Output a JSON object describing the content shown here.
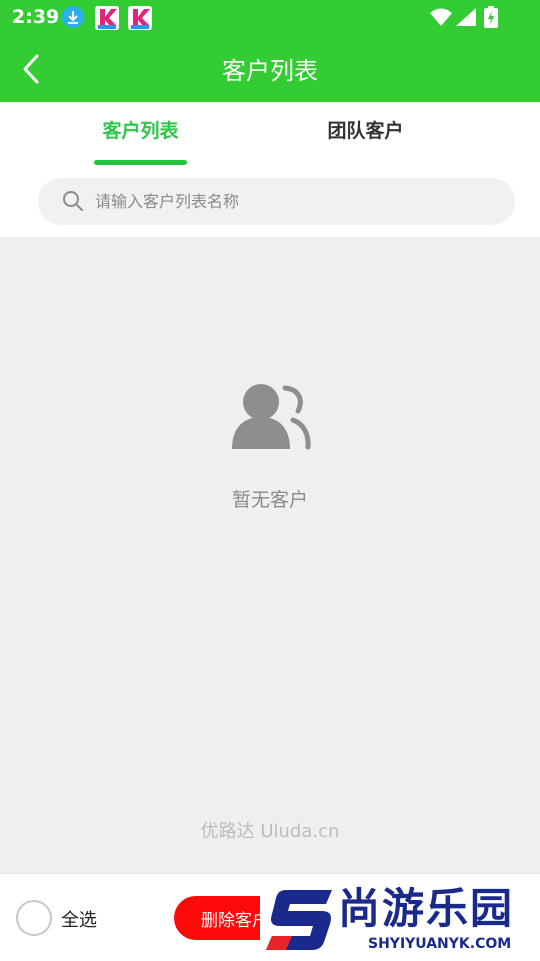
{
  "status_bar": {
    "time": "2:39"
  },
  "header": {
    "title": "客户列表"
  },
  "tabs": [
    {
      "label": "客户列表",
      "active": true
    },
    {
      "label": "团队客户",
      "active": false
    }
  ],
  "search": {
    "placeholder": "请输入客户列表名称",
    "value": ""
  },
  "empty_state": {
    "text": "暂无客户",
    "icon": "customers-icon"
  },
  "watermark": "优路达 Uluda.cn",
  "footer": {
    "select_all_label": "全选",
    "delete_label": "删除客户"
  },
  "brand": {
    "name": "尚游乐园",
    "url": "SHYIYUANYK.COM"
  },
  "colors": {
    "primary": "#33cc33",
    "tab_active": "#2fc44a",
    "danger": "#ff0a0a",
    "background": "#efefef"
  }
}
